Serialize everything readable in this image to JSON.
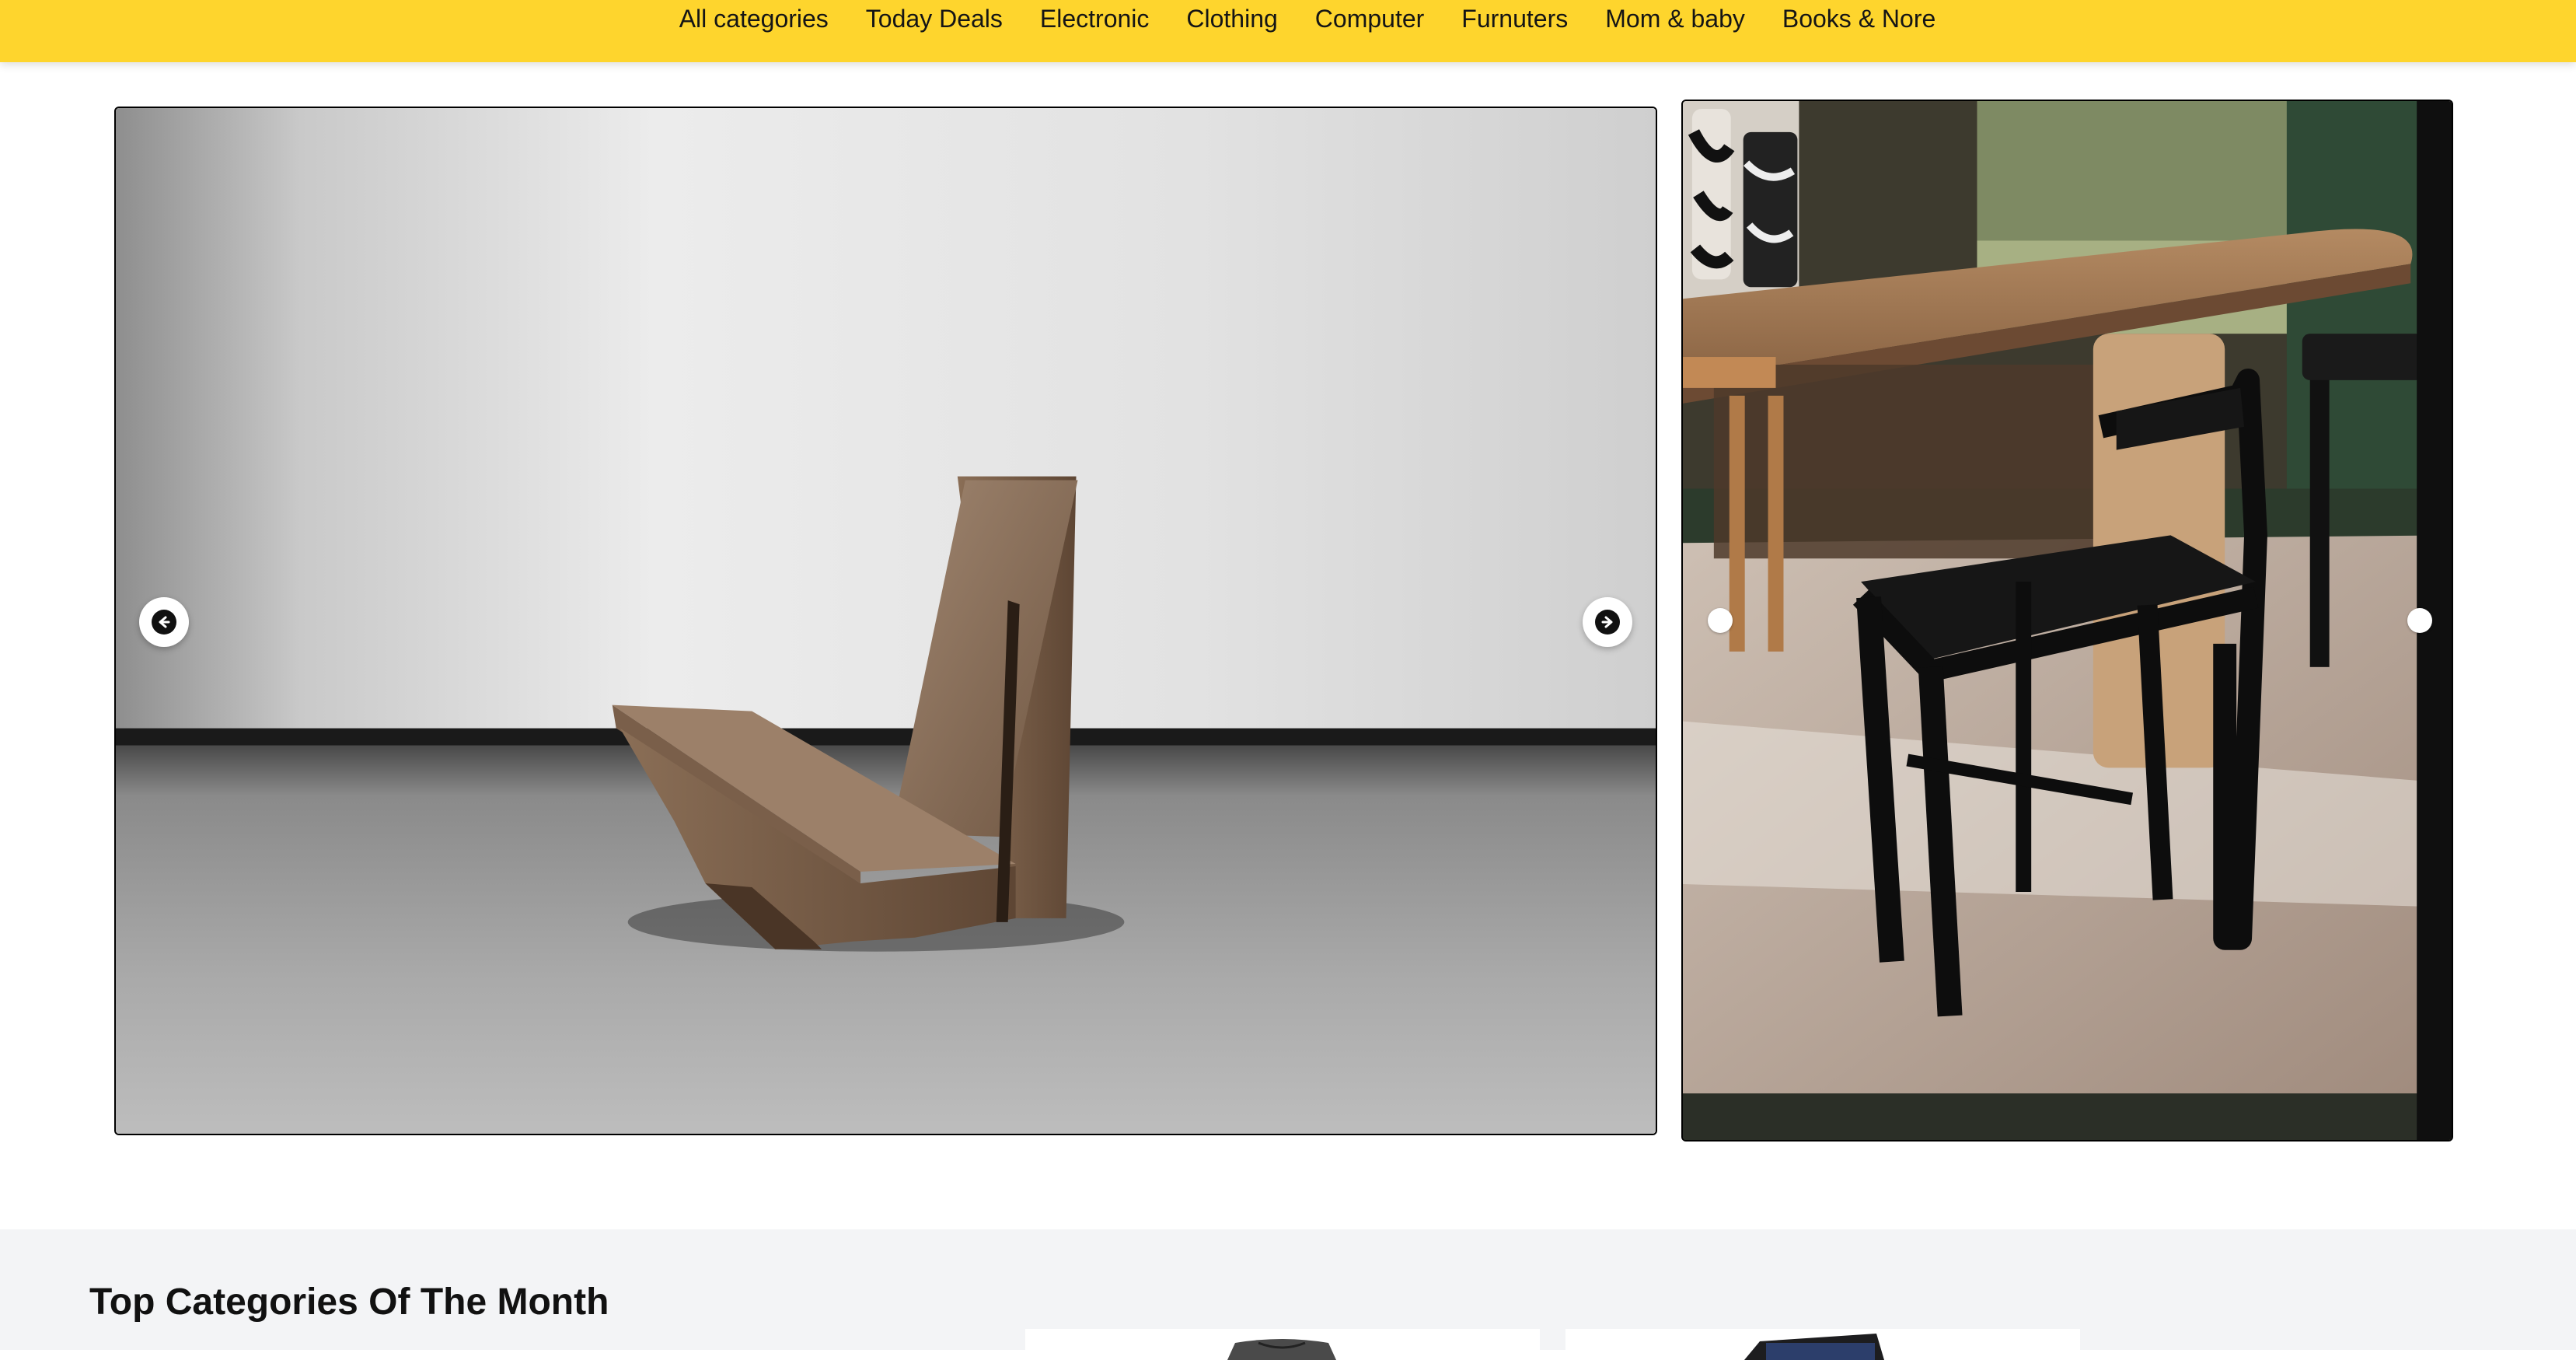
{
  "nav": {
    "items": [
      {
        "label": "All categories",
        "name": "nav-all-categories"
      },
      {
        "label": "Today Deals",
        "name": "nav-today-deals"
      },
      {
        "label": "Electronic",
        "name": "nav-electronic"
      },
      {
        "label": "Clothing",
        "name": "nav-clothing"
      },
      {
        "label": "Computer",
        "name": "nav-computer"
      },
      {
        "label": "Furnuters",
        "name": "nav-furnuters"
      },
      {
        "label": "Mom & baby",
        "name": "nav-mom-baby"
      },
      {
        "label": "Books & Nore",
        "name": "nav-books-nore"
      }
    ]
  },
  "hero": {
    "prev_icon": "arrow-left-icon",
    "next_icon": "arrow-right-icon"
  },
  "categories": {
    "title": "Top Categories Of The Month"
  },
  "colors": {
    "nav_background": "#fed52d",
    "section_background": "#f3f4f6"
  }
}
